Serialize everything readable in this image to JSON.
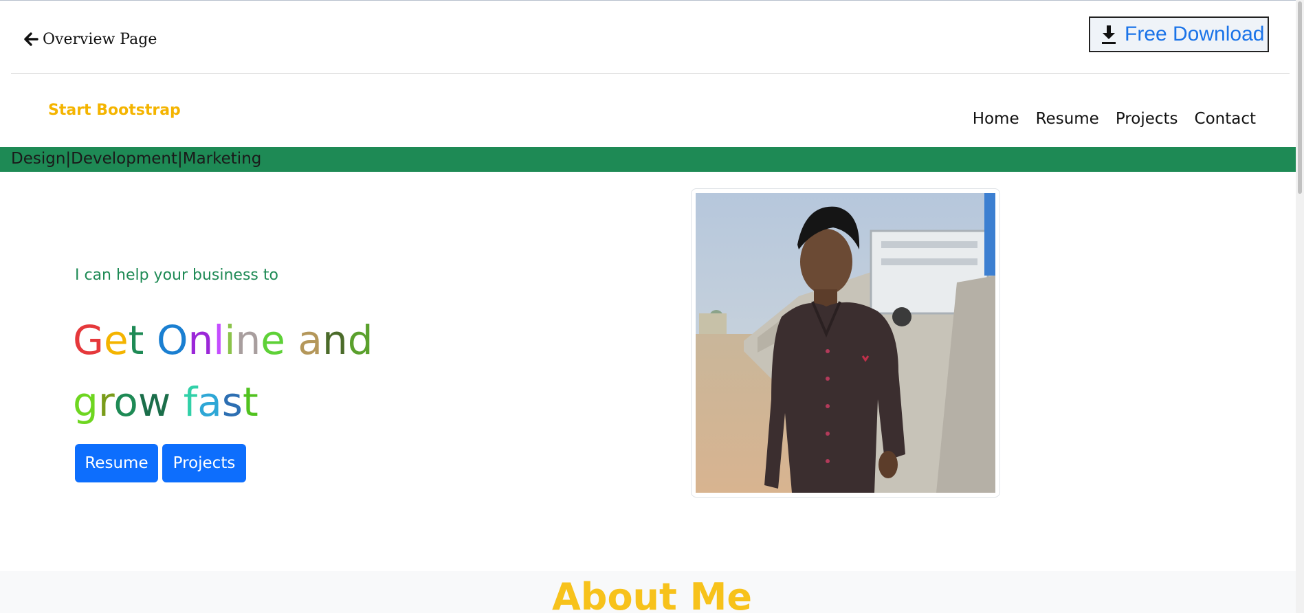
{
  "topbar": {
    "back_label": "Overview Page",
    "download_label": "Free Download"
  },
  "navbar": {
    "brand": "Start Bootstrap",
    "items": [
      {
        "label": "Home"
      },
      {
        "label": "Resume"
      },
      {
        "label": "Projects"
      },
      {
        "label": "Contact"
      }
    ]
  },
  "strip": {
    "text": "Design|Development|Marketing",
    "color": "#1e8a55"
  },
  "hero": {
    "subtitle": "I can help your business to",
    "title_line1": "Get Online and",
    "title_line2": "grow fast",
    "letter_colors_line1": [
      "#e5383b",
      "#f4b400",
      "#1e8a55",
      "",
      "#1a7fd1",
      "#9b27d8",
      "#c44dff",
      "#8bc34a",
      "#a89e9e",
      "#5ed137",
      "",
      "#b4975a",
      "#4b6b2a",
      "#5aa02c"
    ],
    "letter_colors_line2": [
      "#6ed620",
      "#7a9c1a",
      "#1e8a55",
      "#1b6e4a",
      "",
      "#31d0a8",
      "#2ea7d6",
      "#2d6fb2",
      "#51c21f"
    ],
    "buttons": [
      {
        "label": "Resume"
      },
      {
        "label": "Projects"
      }
    ]
  },
  "about": {
    "heading": "About Me"
  },
  "icons": {
    "back": "arrow-left-icon",
    "download": "download-icon"
  }
}
